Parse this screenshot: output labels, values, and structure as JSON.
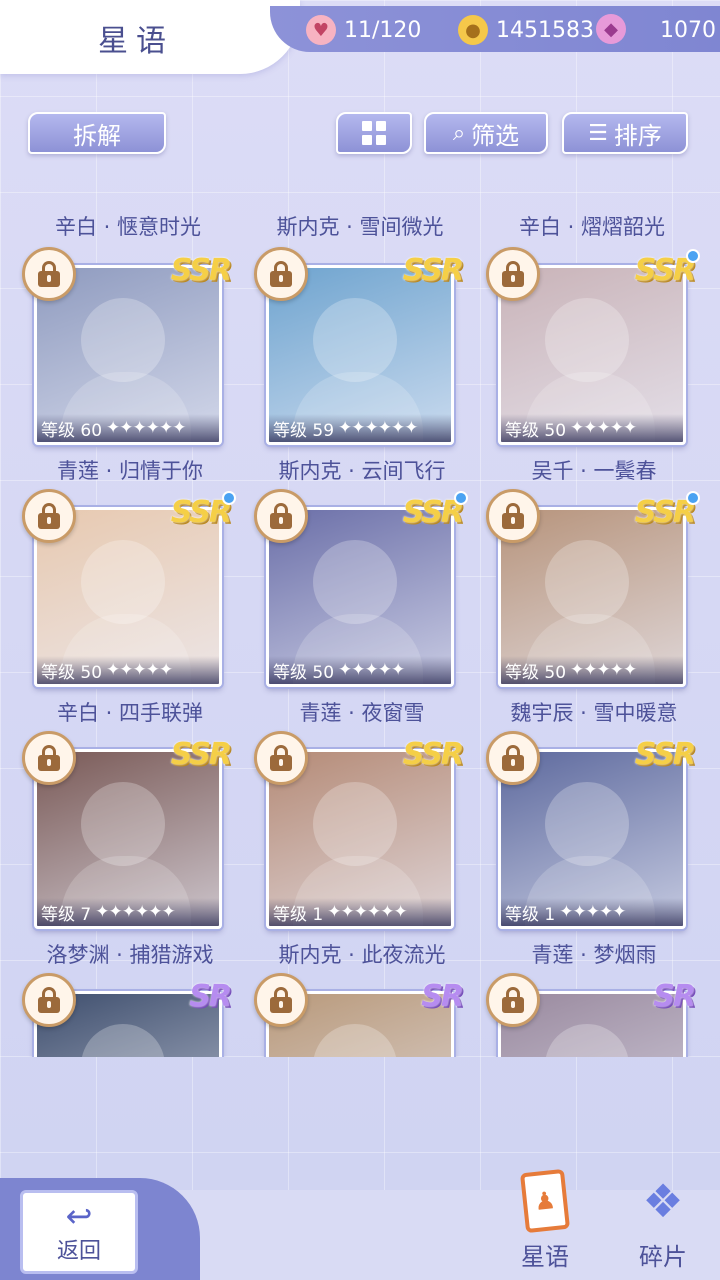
{
  "header": {
    "title": "星语",
    "resources": {
      "stamina": "11/120",
      "gold": "1451583",
      "diamonds": "1070"
    }
  },
  "toolbar": {
    "dismantle": "拆解",
    "filter": "筛选",
    "sort": "排序"
  },
  "top_row_names": [
    "辛白 · 惬意时光",
    "斯内克 · 雪间微光",
    "辛白 · 熠熠韶光"
  ],
  "cards": [
    {
      "name": "青莲 · 归情于你",
      "level": "等级 60",
      "stars": "✦✦✦✦✦✦",
      "rarity": "SSR",
      "new": false,
      "color": "#8f9bbf"
    },
    {
      "name": "斯内克 · 云间飞行",
      "level": "等级 59",
      "stars": "✦✦✦✦✦✦",
      "rarity": "SSR",
      "new": false,
      "color": "#6fa4cf"
    },
    {
      "name": "吴千 · 一鬓春",
      "level": "等级 50",
      "stars": "✦✦✦✦✦",
      "rarity": "SSR",
      "new": true,
      "color": "#c9b3b8"
    },
    {
      "name": "辛白 · 四手联弹",
      "level": "等级 50",
      "stars": "✦✦✦✦✦",
      "rarity": "SSR",
      "new": true,
      "color": "#e7c9b0"
    },
    {
      "name": "青莲 · 夜窗雪",
      "level": "等级 50",
      "stars": "✦✦✦✦✦",
      "rarity": "SSR",
      "new": true,
      "color": "#6b6fa8"
    },
    {
      "name": "魏宇辰 · 雪中暖意",
      "level": "等级 50",
      "stars": "✦✦✦✦✦",
      "rarity": "SSR",
      "new": true,
      "color": "#b7947c"
    },
    {
      "name": "洛梦渊 · 捕猎游戏",
      "level": "等级 7",
      "stars": "✦✦✦✦✦✦",
      "rarity": "SSR",
      "new": false,
      "color": "#7a5a57"
    },
    {
      "name": "斯内克 · 此夜流光",
      "level": "等级 1",
      "stars": "✦✦✦✦✦✦",
      "rarity": "SSR",
      "new": false,
      "color": "#b58b77"
    },
    {
      "name": "青莲 · 梦烟雨",
      "level": "等级 1",
      "stars": "✦✦✦✦✦",
      "rarity": "SSR",
      "new": false,
      "color": "#5e6a9e"
    },
    {
      "name": "",
      "level": "",
      "stars": "",
      "rarity": "SR",
      "new": false,
      "color": "#3f4f6e"
    },
    {
      "name": "",
      "level": "",
      "stars": "",
      "rarity": "SR",
      "new": false,
      "color": "#b99a7c"
    },
    {
      "name": "",
      "level": "",
      "stars": "",
      "rarity": "SR",
      "new": false,
      "color": "#9a8a9f"
    }
  ],
  "bottom": {
    "back": "返回",
    "cards_tab": "星语",
    "fragments_tab": "碎片"
  }
}
